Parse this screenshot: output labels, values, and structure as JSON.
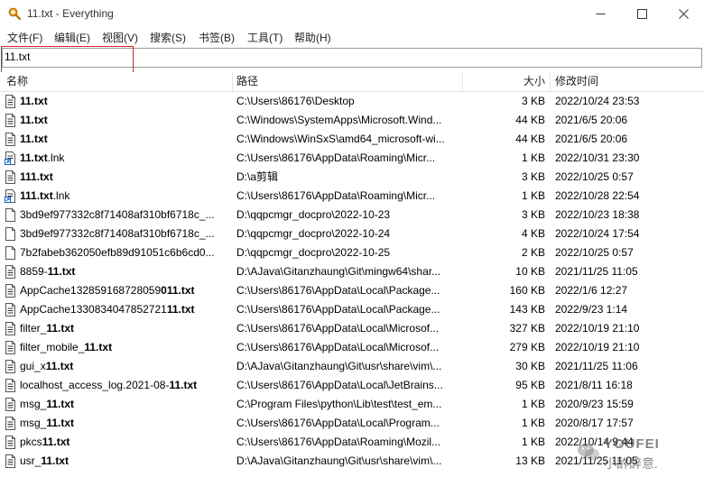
{
  "window": {
    "title": "11.txt - Everything"
  },
  "menu": [
    "文件(F)",
    "编辑(E)",
    "视图(V)",
    "搜索(S)",
    "书签(B)",
    "工具(T)",
    "帮助(H)"
  ],
  "search": {
    "value": "11.txt"
  },
  "columns": {
    "name": "名称",
    "path": "路径",
    "size": "大小",
    "modified": "修改时间"
  },
  "rows": [
    {
      "name_pre": "",
      "name_hl": "11.txt",
      "name_post": "",
      "path": "C:\\Users\\86176\\Desktop",
      "size": "3 KB",
      "modified": "2022/10/24 23:53",
      "icon": "text-file-icon"
    },
    {
      "name_pre": "",
      "name_hl": "11.txt",
      "name_post": "",
      "path": "C:\\Windows\\SystemApps\\Microsoft.Wind...",
      "size": "44 KB",
      "modified": "2021/6/5 20:06",
      "icon": "text-file-icon"
    },
    {
      "name_pre": "",
      "name_hl": "11.txt",
      "name_post": "",
      "path": "C:\\Windows\\WinSxS\\amd64_microsoft-wi...",
      "size": "44 KB",
      "modified": "2021/6/5 20:06",
      "icon": "text-file-icon"
    },
    {
      "name_pre": "",
      "name_hl": "11.txt",
      "name_post": ".lnk",
      "path": "C:\\Users\\86176\\AppData\\Roaming\\Micr...",
      "size": "1 KB",
      "modified": "2022/10/31 23:30",
      "icon": "shortcut-file-icon"
    },
    {
      "name_pre": "",
      "name_hl": "111.txt",
      "name_post": "",
      "path": "D:\\a剪辑",
      "size": "3 KB",
      "modified": "2022/10/25 0:57",
      "icon": "text-file-icon"
    },
    {
      "name_pre": "",
      "name_hl": "111.txt",
      "name_post": ".lnk",
      "path": "C:\\Users\\86176\\AppData\\Roaming\\Micr...",
      "size": "1 KB",
      "modified": "2022/10/28 22:54",
      "icon": "shortcut-file-icon"
    },
    {
      "name_pre": "3bd9ef977332c8f71408af310bf6718c_...",
      "name_hl": "",
      "name_post": "",
      "path": "D:\\qqpcmgr_docpro\\2022-10-23",
      "size": "3 KB",
      "modified": "2022/10/23 18:38",
      "icon": "blank-file-icon"
    },
    {
      "name_pre": "3bd9ef977332c8f71408af310bf6718c_...",
      "name_hl": "",
      "name_post": "",
      "path": "D:\\qqpcmgr_docpro\\2022-10-24",
      "size": "4 KB",
      "modified": "2022/10/24 17:54",
      "icon": "blank-file-icon"
    },
    {
      "name_pre": "7b2fabeb362050efb89d91051c6b6cd0...",
      "name_hl": "",
      "name_post": "",
      "path": "D:\\qqpcmgr_docpro\\2022-10-25",
      "size": "2 KB",
      "modified": "2022/10/25 0:57",
      "icon": "blank-file-icon"
    },
    {
      "name_pre": "8859-",
      "name_hl": "11.txt",
      "name_post": "",
      "path": "D:\\AJava\\Gitanzhaung\\Git\\mingw64\\shar...",
      "size": "10 KB",
      "modified": "2021/11/25 11:05",
      "icon": "text-file-icon"
    },
    {
      "name_pre": "AppCache132859168728059",
      "name_hl": "011.txt",
      "name_post": "",
      "path": "C:\\Users\\86176\\AppData\\Local\\Package...",
      "size": "160 KB",
      "modified": "2022/1/6 12:27",
      "icon": "text-file-icon"
    },
    {
      "name_pre": "AppCache1330834047852721",
      "name_hl": "11.txt",
      "name_post": "",
      "path": "C:\\Users\\86176\\AppData\\Local\\Package...",
      "size": "143 KB",
      "modified": "2022/9/23 1:14",
      "icon": "text-file-icon"
    },
    {
      "name_pre": "filter_",
      "name_hl": "11.txt",
      "name_post": "",
      "path": "C:\\Users\\86176\\AppData\\Local\\Microsof...",
      "size": "327 KB",
      "modified": "2022/10/19 21:10",
      "icon": "text-file-icon"
    },
    {
      "name_pre": "filter_mobile_",
      "name_hl": "11.txt",
      "name_post": "",
      "path": "C:\\Users\\86176\\AppData\\Local\\Microsof...",
      "size": "279 KB",
      "modified": "2022/10/19 21:10",
      "icon": "text-file-icon"
    },
    {
      "name_pre": "gui_x",
      "name_hl": "11.txt",
      "name_post": "",
      "path": "D:\\AJava\\Gitanzhaung\\Git\\usr\\share\\vim\\...",
      "size": "30 KB",
      "modified": "2021/11/25 11:06",
      "icon": "text-file-icon"
    },
    {
      "name_pre": "localhost_access_log.2021-08-",
      "name_hl": "11.txt",
      "name_post": "",
      "path": "C:\\Users\\86176\\AppData\\Local\\JetBrains...",
      "size": "95 KB",
      "modified": "2021/8/11 16:18",
      "icon": "text-file-icon"
    },
    {
      "name_pre": "msg_",
      "name_hl": "11.txt",
      "name_post": "",
      "path": "C:\\Program Files\\python\\Lib\\test\\test_em...",
      "size": "1 KB",
      "modified": "2020/9/23 15:59",
      "icon": "text-file-icon"
    },
    {
      "name_pre": "msg_",
      "name_hl": "11.txt",
      "name_post": "",
      "path": "C:\\Users\\86176\\AppData\\Local\\Program...",
      "size": "1 KB",
      "modified": "2020/8/17 17:57",
      "icon": "text-file-icon"
    },
    {
      "name_pre": "pkcs",
      "name_hl": "11.txt",
      "name_post": "",
      "path": "C:\\Users\\86176\\AppData\\Roaming\\Mozil...",
      "size": "1 KB",
      "modified": "2022/10/14 9:44",
      "icon": "text-file-icon"
    },
    {
      "name_pre": "usr_",
      "name_hl": "11.txt",
      "name_post": "",
      "path": "D:\\AJava\\Gitanzhaung\\Git\\usr\\share\\vim\\...",
      "size": "13 KB",
      "modified": "2021/11/25 11:05",
      "icon": "text-file-icon"
    }
  ],
  "watermark": {
    "line1": "YOUFEI",
    "line2": "小酢醉意."
  }
}
